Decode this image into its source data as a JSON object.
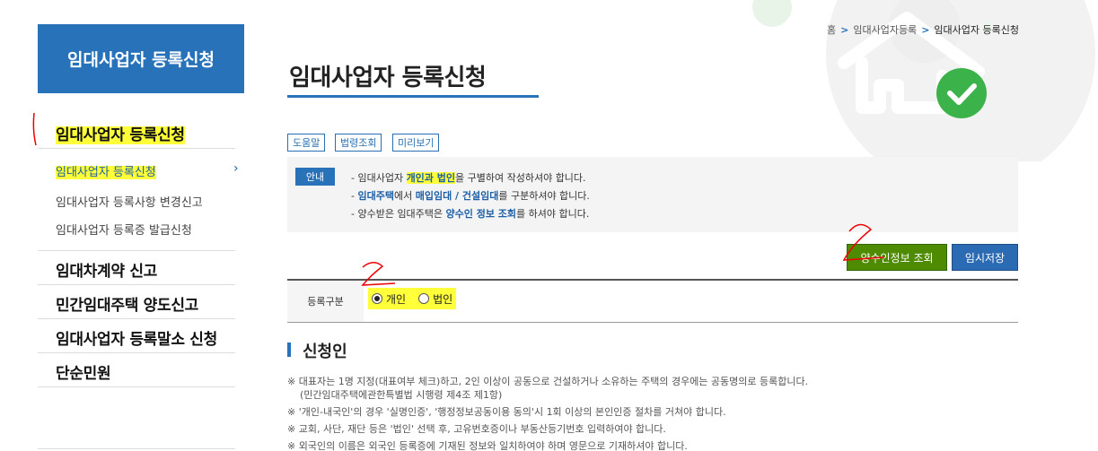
{
  "sidebar": {
    "header": "임대사업자 등록신청",
    "section1": {
      "title": "임대사업자 등록신청",
      "items": [
        "임대사업자 등록신청",
        "임대사업자 등록사항 변경신고",
        "임대사업자 등록증 발급신청"
      ]
    },
    "sections": [
      "임대차계약 신고",
      "민간임대주택 양도신고",
      "임대사업자 등록말소 신청",
      "단순민원"
    ]
  },
  "breadcrumb": {
    "home": "홈",
    "level1": "임대사업자등록",
    "current": "임대사업자 등록신청"
  },
  "page": {
    "title": "임대사업자 등록신청"
  },
  "tools": [
    "도움말",
    "법령조회",
    "미리보기"
  ],
  "notice": {
    "tag": "안내",
    "line1": {
      "pre": "- 임대사업자 ",
      "em": "개인과 법인",
      "post": "을 구별하여 작성하셔야 합니다."
    },
    "line2": {
      "pre": "- ",
      "em1": "임대주택",
      "mid1": "에서 ",
      "em2": "매입임대 / 건설임대",
      "post": "를 구분하셔야 합니다."
    },
    "line3": {
      "pre": "- 양수받은 임대주택은 ",
      "em": "양수인 정보 조회",
      "post": "를 하셔야 합니다."
    }
  },
  "buttons": {
    "lookup": "양수인정보 조회",
    "save": "임시저장"
  },
  "form": {
    "label": "등록구분",
    "options": [
      "개인",
      "법인"
    ],
    "selected": "개인"
  },
  "section": {
    "title": "신청인",
    "notes": [
      "※ 대표자는 1명 지정(대표여부 체크)하고, 2인 이상이 공동으로 건설하거나 소유하는 주택의 경우에는 공동명의로 등록합니다.",
      "(민간임대주택에관한특별법 시행령 제4조 제1항)",
      "※ '개인-내국인'의 경우 '실명인증', '행정정보공동이용 동의'시 1회 이상의 본인인증 절차를 거쳐야 합니다.",
      "※ 교회, 사단, 재단 등은 '법인' 선택 후, 고유번호증이나 부동산등기번호 입력하여야 합니다.",
      "※ 외국인의 이름은 외국인 등록증에 기재된 정보와 일치하여야 하며 영문으로 기재하셔야 합니다."
    ]
  },
  "annotations": {
    "mark2a": "2",
    "mark2b": "2"
  }
}
